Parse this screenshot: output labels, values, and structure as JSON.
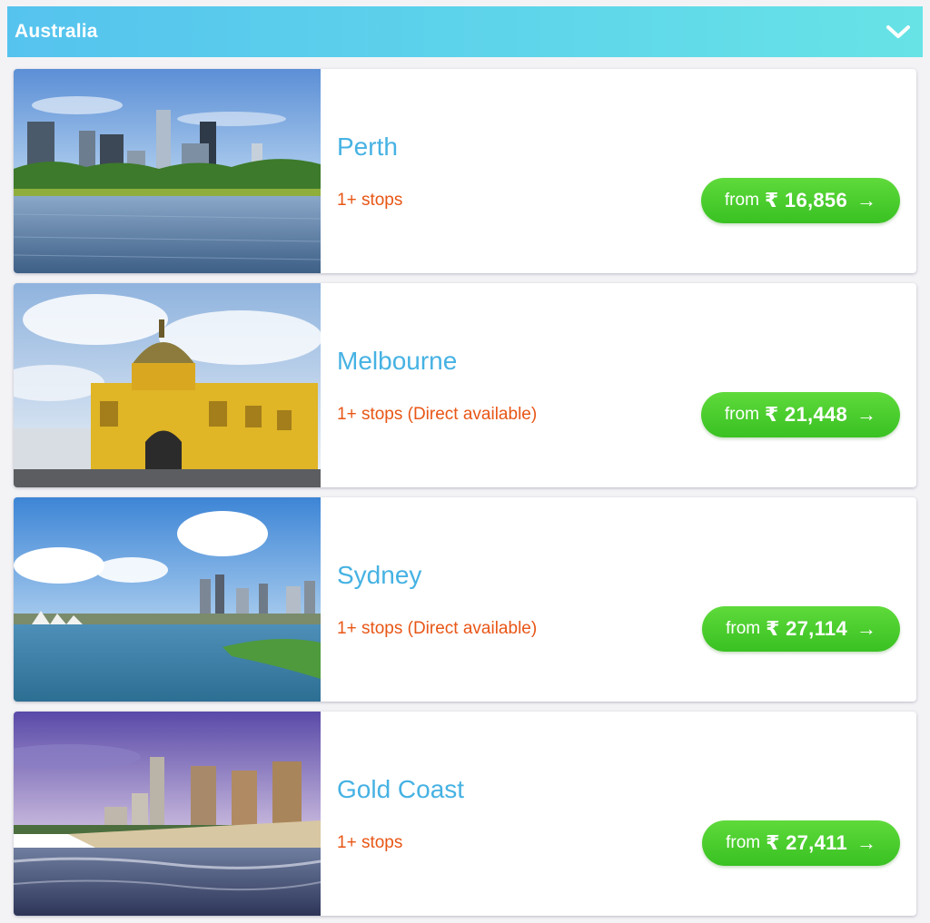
{
  "region": {
    "title": "Australia",
    "toggle_icon": "chevron-down-icon"
  },
  "destinations": [
    {
      "city": "Perth",
      "stops": "1+ stops",
      "from_label": "from",
      "price": "₹ 16,856",
      "arrow": "→",
      "image": "perth-skyline-image"
    },
    {
      "city": "Melbourne",
      "stops": "1+ stops (Direct available)",
      "from_label": "from",
      "price": "₹ 21,448",
      "arrow": "→",
      "image": "melbourne-station-image"
    },
    {
      "city": "Sydney",
      "stops": "1+ stops (Direct available)",
      "from_label": "from",
      "price": "₹ 27,114",
      "arrow": "→",
      "image": "sydney-harbour-image"
    },
    {
      "city": "Gold Coast",
      "stops": "1+ stops",
      "from_label": "from",
      "price": "₹ 27,411",
      "arrow": "→",
      "image": "gold-coast-beach-image"
    }
  ],
  "colors": {
    "header": "#5fd6ea",
    "city": "#46b2e3",
    "stops": "#e85616",
    "button": "#45c72a"
  }
}
